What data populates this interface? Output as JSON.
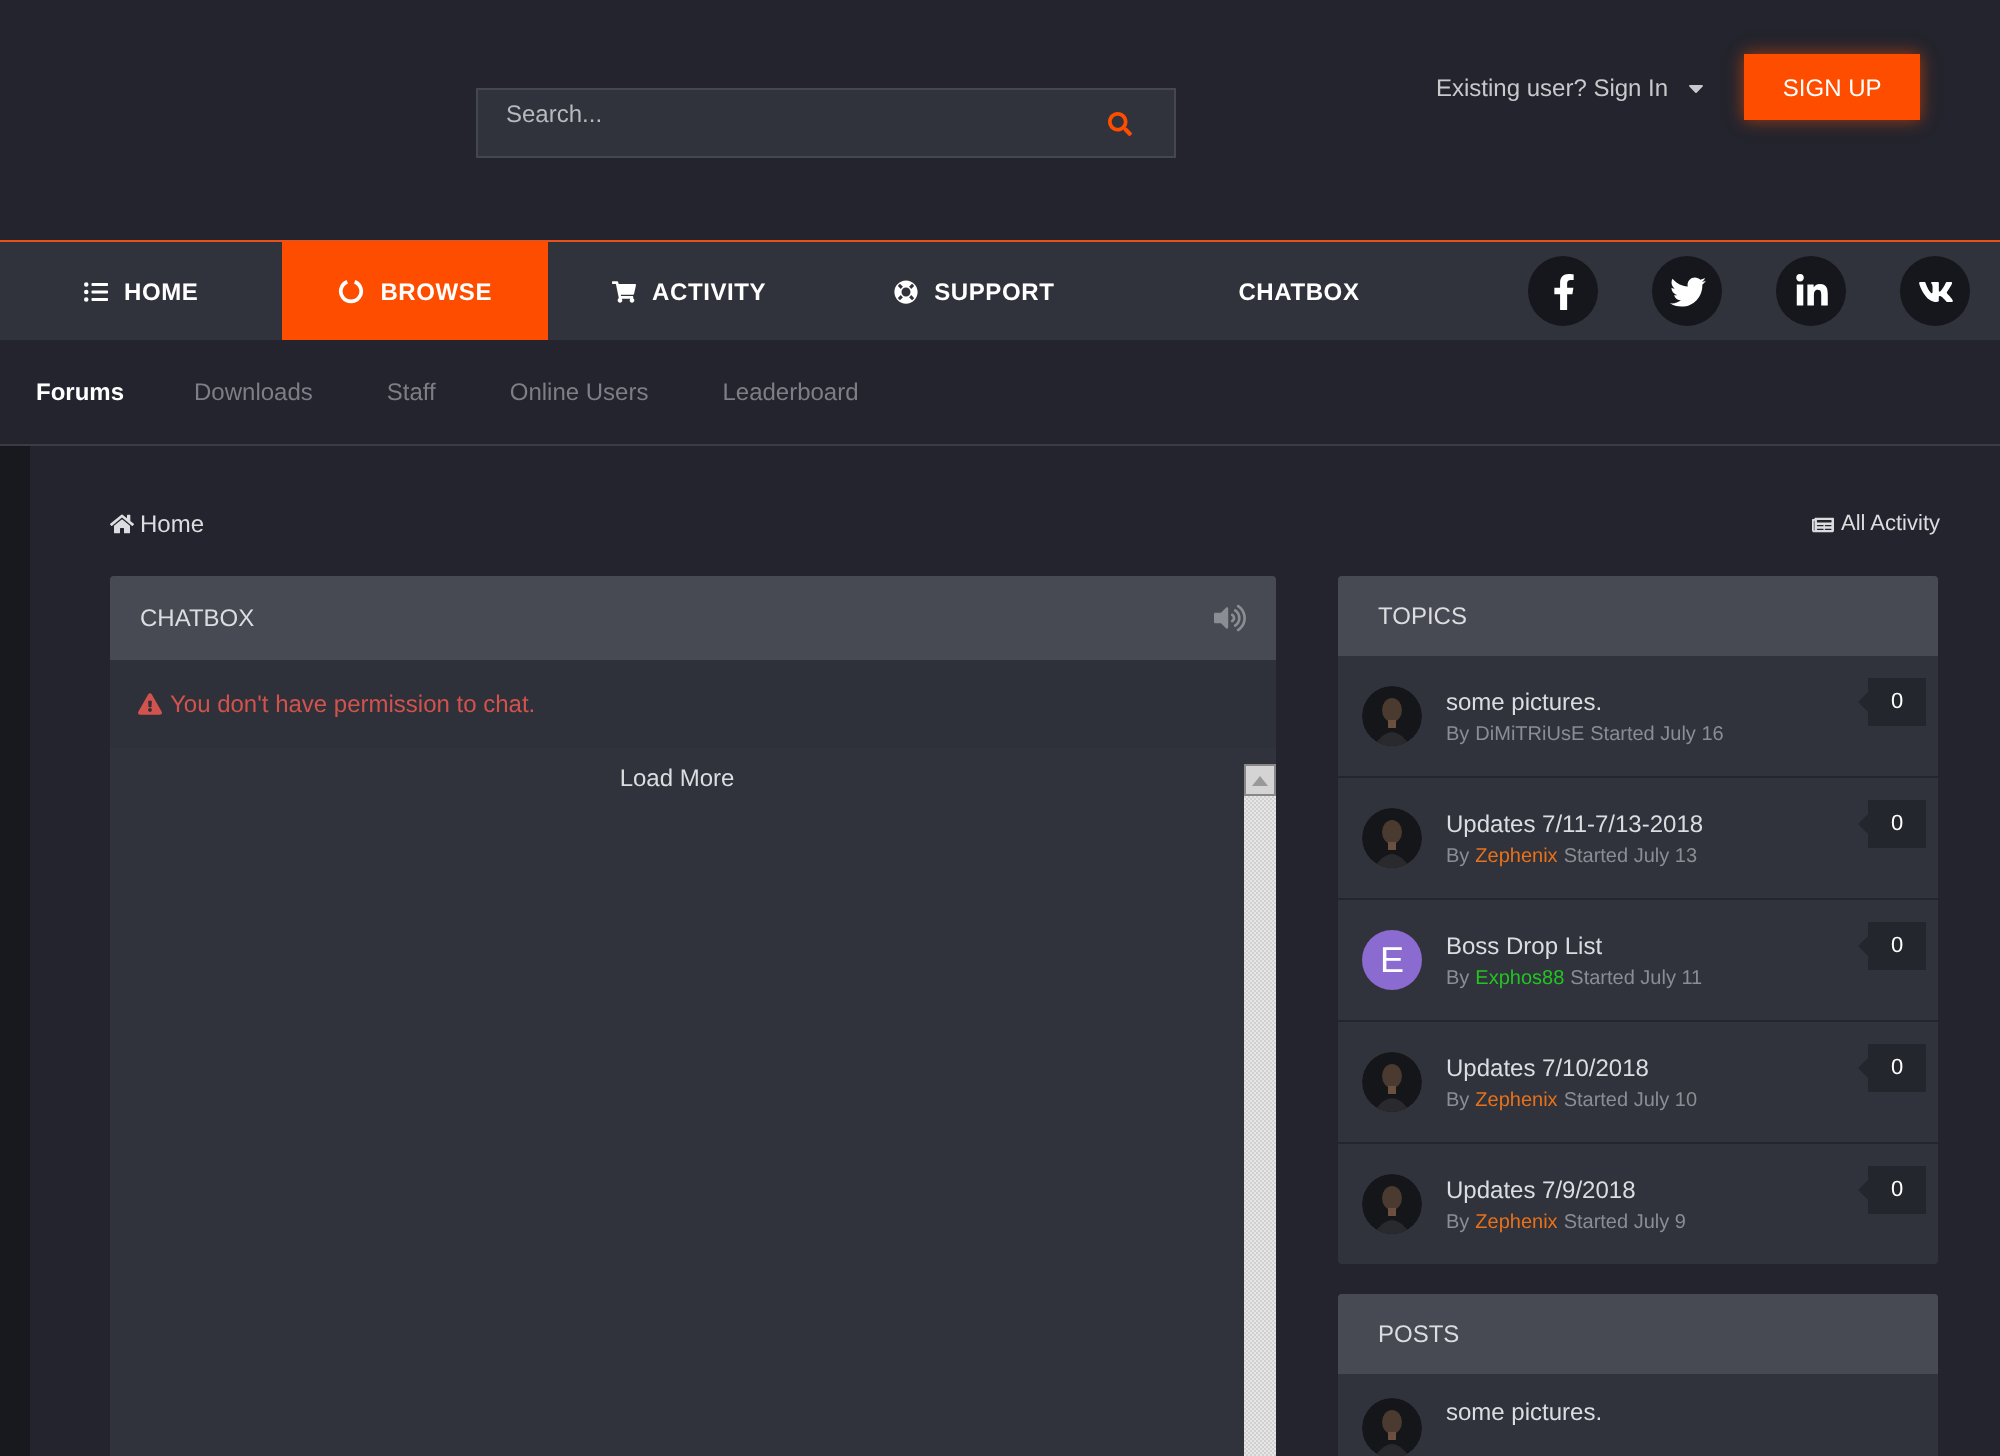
{
  "header": {
    "search": {
      "placeholder": "Search..."
    },
    "sign_in": "Existing user? Sign In",
    "sign_up": "SIGN UP"
  },
  "nav": {
    "items": [
      {
        "label": "HOME",
        "selected": false
      },
      {
        "label": "BROWSE",
        "selected": true
      },
      {
        "label": "ACTIVITY",
        "selected": false
      },
      {
        "label": "SUPPORT",
        "selected": false
      },
      {
        "label": "CHATBOX",
        "selected": false
      }
    ]
  },
  "subnav": [
    {
      "label": "Forums",
      "selected": true
    },
    {
      "label": "Downloads",
      "selected": false
    },
    {
      "label": "Staff",
      "selected": false
    },
    {
      "label": "Online Users",
      "selected": false
    },
    {
      "label": "Leaderboard",
      "selected": false
    }
  ],
  "breadcrumb": "Home",
  "all_activity": "All Activity",
  "chatbox": {
    "title": "CHATBOX",
    "error": "You don't have permission to chat.",
    "load_more": "Load More"
  },
  "topics": {
    "title": "TOPICS",
    "items": [
      {
        "title": "some pictures.",
        "by": "By",
        "author": "DiMiTRiUsE",
        "color": "#8a8d94",
        "started": "Started July 16",
        "count": "0"
      },
      {
        "title": "Updates 7/11-7/13-2018",
        "by": "By",
        "author": "Zephenix",
        "color": "#e8711a",
        "started": "Started July 13",
        "count": "0"
      },
      {
        "title": "Boss Drop List",
        "by": "By",
        "author": "Exphos88",
        "color": "#22c422",
        "started": "Started July 11",
        "count": "0",
        "avatar": {
          "kind": "letter",
          "letter": "E",
          "color": "#8c6bd0"
        }
      },
      {
        "title": "Updates 7/10/2018",
        "by": "By",
        "author": "Zephenix",
        "color": "#e8711a",
        "started": "Started July 10",
        "count": "0"
      },
      {
        "title": "Updates 7/9/2018",
        "by": "By",
        "author": "Zephenix",
        "color": "#e8711a",
        "started": "Started July 9",
        "count": "0"
      }
    ]
  },
  "posts": {
    "title": "POSTS",
    "items": [
      {
        "title": "some pictures."
      }
    ]
  }
}
